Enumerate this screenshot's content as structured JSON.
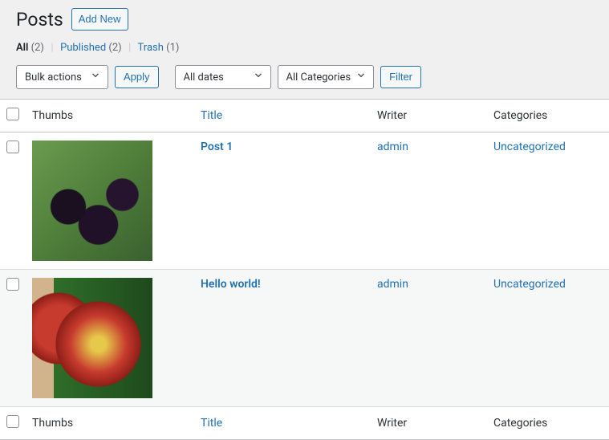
{
  "header": {
    "title": "Posts",
    "add_new": "Add New"
  },
  "filters": {
    "all_label": "All",
    "all_count": "(2)",
    "published_label": "Published",
    "published_count": "(2)",
    "trash_label": "Trash",
    "trash_count": "(1)"
  },
  "tablenav": {
    "bulk_actions": "Bulk actions",
    "apply": "Apply",
    "all_dates": "All dates",
    "all_categories": "All Categories",
    "filter": "Filter"
  },
  "columns": {
    "thumbs": "Thumbs",
    "title": "Title",
    "writer": "Writer",
    "categories": "Categories"
  },
  "rows": [
    {
      "title": "Post 1",
      "writer": "admin",
      "categories": "Uncategorized",
      "thumb_class": "berries",
      "thumb_alt": "blackberries"
    },
    {
      "title": "Hello world!",
      "writer": "admin",
      "categories": "Uncategorized",
      "thumb_class": "apples",
      "thumb_alt": "apples"
    }
  ]
}
